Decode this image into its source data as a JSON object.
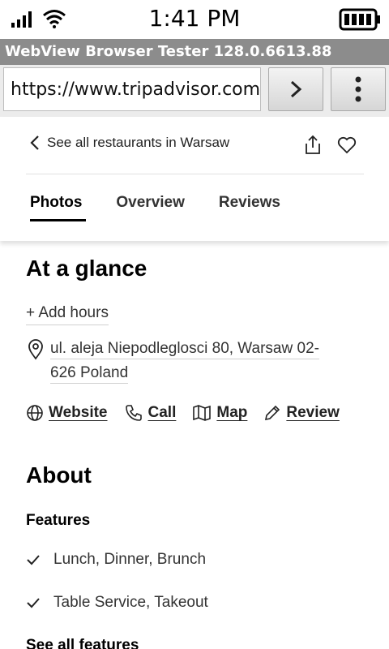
{
  "status": {
    "time": "1:41 PM"
  },
  "webview": {
    "title": "WebView Browser Tester 128.0.6613.88",
    "url": "https://www.tripadvisor.com"
  },
  "page": {
    "back_link": "See all restaurants in Warsaw",
    "tabs": [
      "Photos",
      "Overview",
      "Reviews"
    ],
    "active_tab": "Photos",
    "glance_title": "At a glance",
    "add_hours": "+ Add hours",
    "address_line1": "ul. aleja Niepodleglosci 80, Warsaw 02-",
    "address_line2": "626 Poland",
    "actions": {
      "website": "Website",
      "call": "Call",
      "map": "Map",
      "review": "Review"
    },
    "about_title": "About",
    "features_title": "Features",
    "features": [
      "Lunch, Dinner, Brunch",
      "Table Service, Takeout"
    ],
    "see_all": "See all features"
  },
  "icons": [
    "signal-icon",
    "wifi-icon",
    "battery-icon",
    "chevron-left-icon",
    "share-icon",
    "heart-icon",
    "location-pin-icon",
    "globe-icon",
    "phone-icon",
    "map-icon",
    "pencil-icon",
    "check-icon",
    "arrow-right-icon",
    "more-vert-icon"
  ]
}
